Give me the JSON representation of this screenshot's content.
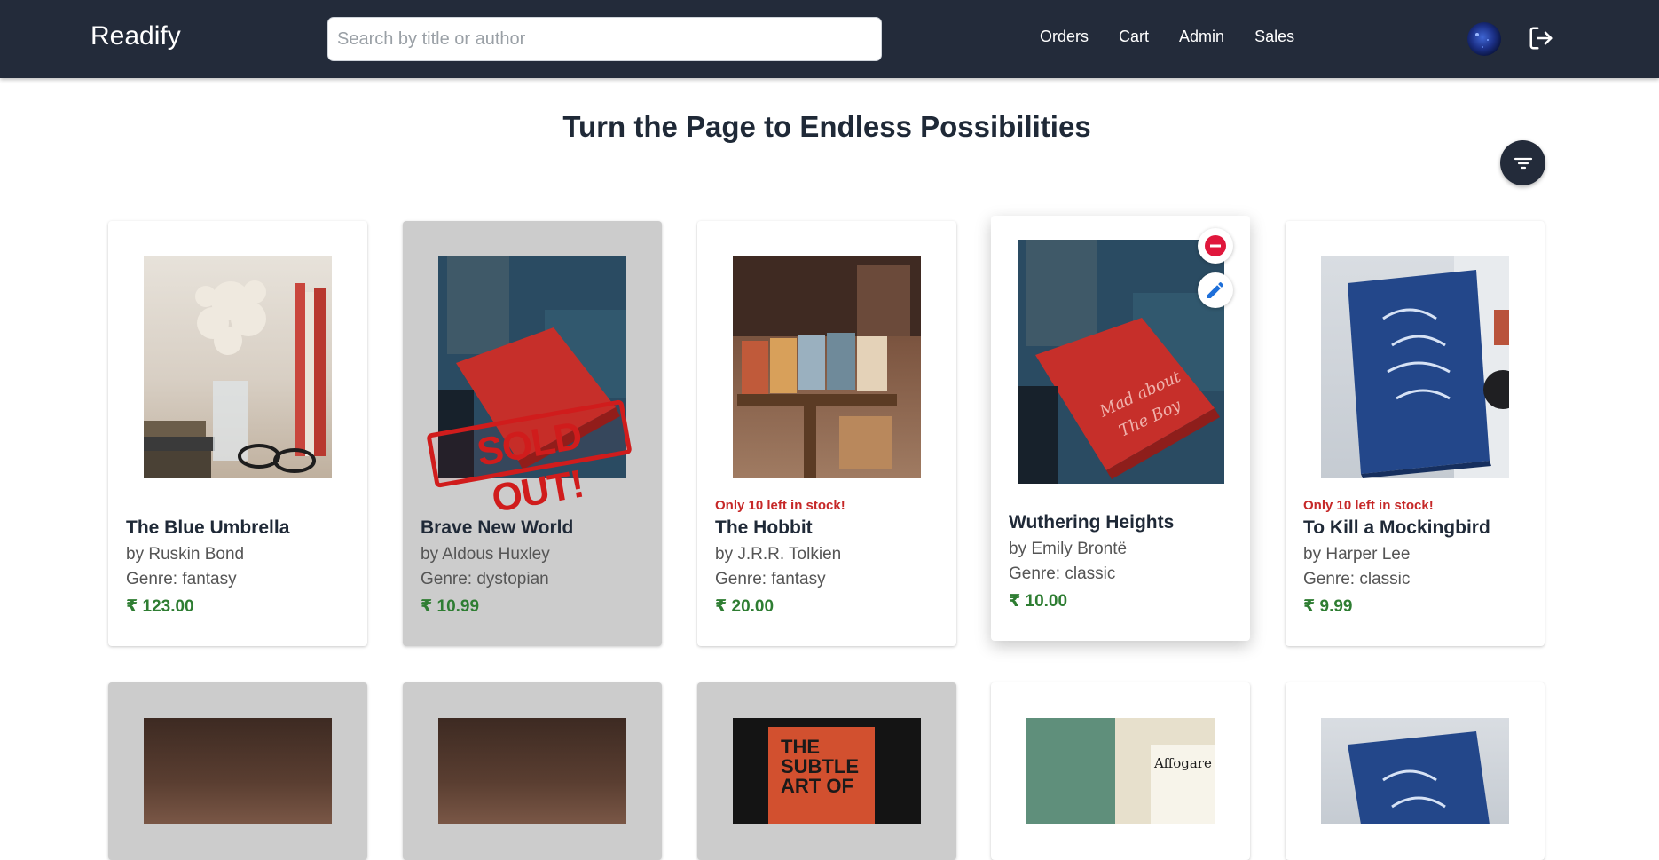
{
  "app": {
    "brand": "Readify",
    "search_placeholder": "Search by title or author",
    "nav": [
      "Orders",
      "Cart",
      "Admin",
      "Sales"
    ]
  },
  "page": {
    "heading": "Turn the Page to Endless Possibilities"
  },
  "colors": {
    "navbar": "#232b3a",
    "price": "#2e7d32",
    "stock_warning": "#c62828",
    "soldout_card": "#cccccc",
    "remove": "#e0173c",
    "edit": "#1e6fd9"
  },
  "icons": {
    "logout": "logout-icon",
    "filter": "filter-icon",
    "remove": "minus-circle-icon",
    "edit": "pencil-icon"
  },
  "books": [
    {
      "title": "The Blue Umbrella",
      "author": "by Ruskin Bond",
      "genre": "Genre: fantasy",
      "price": "₹ 123.00",
      "stock_note": "",
      "sold_out": false
    },
    {
      "title": "Brave New World",
      "author": "by Aldous Huxley",
      "genre": "Genre: dystopian",
      "price": "₹ 10.99",
      "stock_note": "",
      "sold_out": true,
      "stamp": "SOLD OUT!"
    },
    {
      "title": "The Hobbit",
      "author": "by J.R.R. Tolkien",
      "genre": "Genre: fantasy",
      "price": "₹ 20.00",
      "stock_note": "Only 10 left in stock!",
      "sold_out": false
    },
    {
      "title": "Wuthering Heights",
      "author": "by Emily Brontë",
      "genre": "Genre: classic",
      "price": "₹ 10.00",
      "stock_note": "",
      "sold_out": false,
      "hovered": true
    },
    {
      "title": "To Kill a Mockingbird",
      "author": "by Harper Lee",
      "genre": "Genre: classic",
      "price": "₹ 9.99",
      "stock_note": "Only 10 left in stock!",
      "sold_out": false
    }
  ],
  "row2_covers": {
    "c3_text": "THE SUBTLE ART OF",
    "c4_text": "Affogare"
  }
}
